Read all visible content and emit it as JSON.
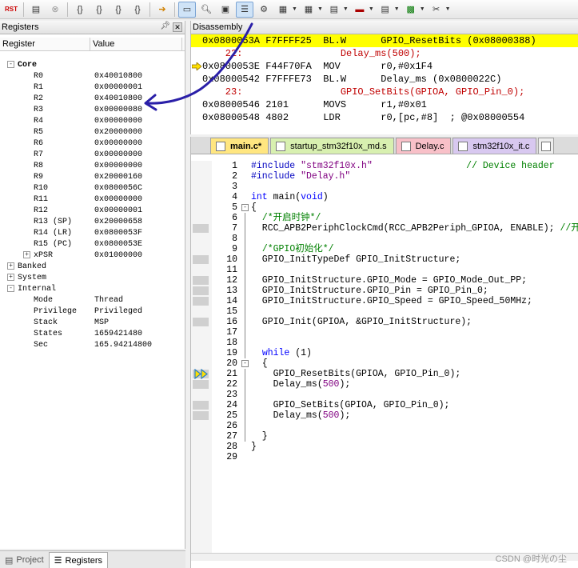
{
  "registers": {
    "title": "Registers",
    "pin_icon": "pin-icon",
    "columns": [
      "Register",
      "Value"
    ],
    "groups": {
      "core": "Core",
      "banked": "Banked",
      "system": "System",
      "internal": "Internal"
    },
    "core": [
      {
        "name": "R0",
        "value": "0x40010800"
      },
      {
        "name": "R1",
        "value": "0x00000001"
      },
      {
        "name": "R2",
        "value": "0x40010800"
      },
      {
        "name": "R3",
        "value": "0x00000080"
      },
      {
        "name": "R4",
        "value": "0x00000000"
      },
      {
        "name": "R5",
        "value": "0x20000000"
      },
      {
        "name": "R6",
        "value": "0x00000000"
      },
      {
        "name": "R7",
        "value": "0x00000000"
      },
      {
        "name": "R8",
        "value": "0x00000000"
      },
      {
        "name": "R9",
        "value": "0x20000160"
      },
      {
        "name": "R10",
        "value": "0x0800056C"
      },
      {
        "name": "R11",
        "value": "0x00000000"
      },
      {
        "name": "R12",
        "value": "0x00000001"
      },
      {
        "name": "R13 (SP)",
        "value": "0x20000658"
      },
      {
        "name": "R14 (LR)",
        "value": "0x0800053F"
      },
      {
        "name": "R15 (PC)",
        "value": "0x0800053E"
      },
      {
        "name": "xPSR",
        "value": "0x01000000"
      }
    ],
    "internal": [
      {
        "name": "Mode",
        "value": "Thread"
      },
      {
        "name": "Privilege",
        "value": "Privileged"
      },
      {
        "name": "Stack",
        "value": "MSP"
      },
      {
        "name": "States",
        "value": "1659421480"
      },
      {
        "name": "Sec",
        "value": "165.94214800"
      }
    ],
    "tabs": [
      "Project",
      "Registers"
    ]
  },
  "disassembly": {
    "title": "Disassembly",
    "lines": [
      {
        "text": "0x0800053A F7FFFF25  BL.W      GPIO_ResetBits (0x08000388)",
        "kind": "cur"
      },
      {
        "text": "    22:                 Delay_ms(500);",
        "kind": "src"
      },
      {
        "text": "0x0800053E F44F70FA  MOV       r0,#0x1F4",
        "kind": "pc"
      },
      {
        "text": "0x08000542 F7FFFE73  BL.W      Delay_ms (0x0800022C)",
        "kind": "asm"
      },
      {
        "text": "    23:                 GPIO_SetBits(GPIOA, GPIO_Pin_0);",
        "kind": "src"
      },
      {
        "text": "0x08000546 2101      MOVS      r1,#0x01",
        "kind": "asm"
      },
      {
        "text": "0x08000548 4802      LDR       r0,[pc,#8]  ; @0x08000554",
        "kind": "asm"
      }
    ]
  },
  "editor": {
    "tabs": [
      "main.c*",
      "startup_stm32f10x_md.s",
      "Delay.c",
      "stm32f10x_it.c"
    ],
    "lines": [
      {
        "n": "1",
        "parts": [
          [
            "pre",
            "#include "
          ],
          [
            "str",
            "\"stm32f10x.h\""
          ],
          [
            "plain",
            "                 "
          ],
          [
            "cmt",
            "// Device header"
          ]
        ]
      },
      {
        "n": "2",
        "parts": [
          [
            "pre",
            "#include "
          ],
          [
            "str",
            "\"Delay.h\""
          ]
        ]
      },
      {
        "n": "3",
        "parts": []
      },
      {
        "n": "4",
        "parts": [
          [
            "kw",
            "int"
          ],
          [
            "plain",
            " main("
          ],
          [
            "kw",
            "void"
          ],
          [
            "plain",
            ")"
          ]
        ]
      },
      {
        "n": "5",
        "parts": [
          [
            "plain",
            "{"
          ]
        ]
      },
      {
        "n": "6",
        "parts": [
          [
            "plain",
            "  "
          ],
          [
            "cmt",
            "/*开启时钟*/"
          ]
        ]
      },
      {
        "n": "7",
        "parts": [
          [
            "plain",
            "  RCC_APB2PeriphClockCmd(RCC_APB2Periph_GPIOA, ENABLE); "
          ],
          [
            "cmt",
            "//开"
          ]
        ]
      },
      {
        "n": "8",
        "parts": []
      },
      {
        "n": "9",
        "parts": [
          [
            "plain",
            "  "
          ],
          [
            "cmt",
            "/*GPIO初始化*/"
          ]
        ]
      },
      {
        "n": "10",
        "parts": [
          [
            "plain",
            "  GPIO_InitTypeDef GPIO_InitStructure;"
          ]
        ]
      },
      {
        "n": "11",
        "parts": []
      },
      {
        "n": "12",
        "parts": [
          [
            "plain",
            "  GPIO_InitStructure.GPIO_Mode = GPIO_Mode_Out_PP;"
          ]
        ]
      },
      {
        "n": "13",
        "parts": [
          [
            "plain",
            "  GPIO_InitStructure.GPIO_Pin = GPIO_Pin_0;"
          ]
        ]
      },
      {
        "n": "14",
        "parts": [
          [
            "plain",
            "  GPIO_InitStructure.GPIO_Speed = GPIO_Speed_50MHz;"
          ]
        ]
      },
      {
        "n": "15",
        "parts": []
      },
      {
        "n": "16",
        "parts": [
          [
            "plain",
            "  GPIO_Init(GPIOA, &GPIO_InitStructure);"
          ]
        ]
      },
      {
        "n": "17",
        "parts": []
      },
      {
        "n": "18",
        "parts": []
      },
      {
        "n": "19",
        "parts": [
          [
            "plain",
            "  "
          ],
          [
            "kw",
            "while"
          ],
          [
            "plain",
            " (1)"
          ]
        ]
      },
      {
        "n": "20",
        "parts": [
          [
            "plain",
            "  {"
          ]
        ]
      },
      {
        "n": "21",
        "parts": [
          [
            "plain",
            "    GPIO_ResetBits(GPIOA, GPIO_Pin_0);"
          ]
        ]
      },
      {
        "n": "22",
        "parts": [
          [
            "plain",
            "    Delay_ms("
          ],
          [
            "num",
            "500"
          ],
          [
            "plain",
            ");"
          ]
        ]
      },
      {
        "n": "23",
        "parts": []
      },
      {
        "n": "24",
        "parts": [
          [
            "plain",
            "    GPIO_SetBits(GPIOA, GPIO_Pin_0);"
          ]
        ]
      },
      {
        "n": "25",
        "parts": [
          [
            "plain",
            "    Delay_ms("
          ],
          [
            "num",
            "500"
          ],
          [
            "plain",
            ");"
          ]
        ]
      },
      {
        "n": "26",
        "parts": []
      },
      {
        "n": "27",
        "parts": [
          [
            "plain",
            "  }"
          ]
        ]
      },
      {
        "n": "28",
        "parts": [
          [
            "plain",
            "}"
          ]
        ]
      },
      {
        "n": "29",
        "parts": []
      }
    ]
  },
  "watermark": "CSDN @时光の尘",
  "colors": {
    "accent_arrow": "#2a1fa8",
    "current_line": "#ffff00",
    "source_line": "#c00000"
  }
}
